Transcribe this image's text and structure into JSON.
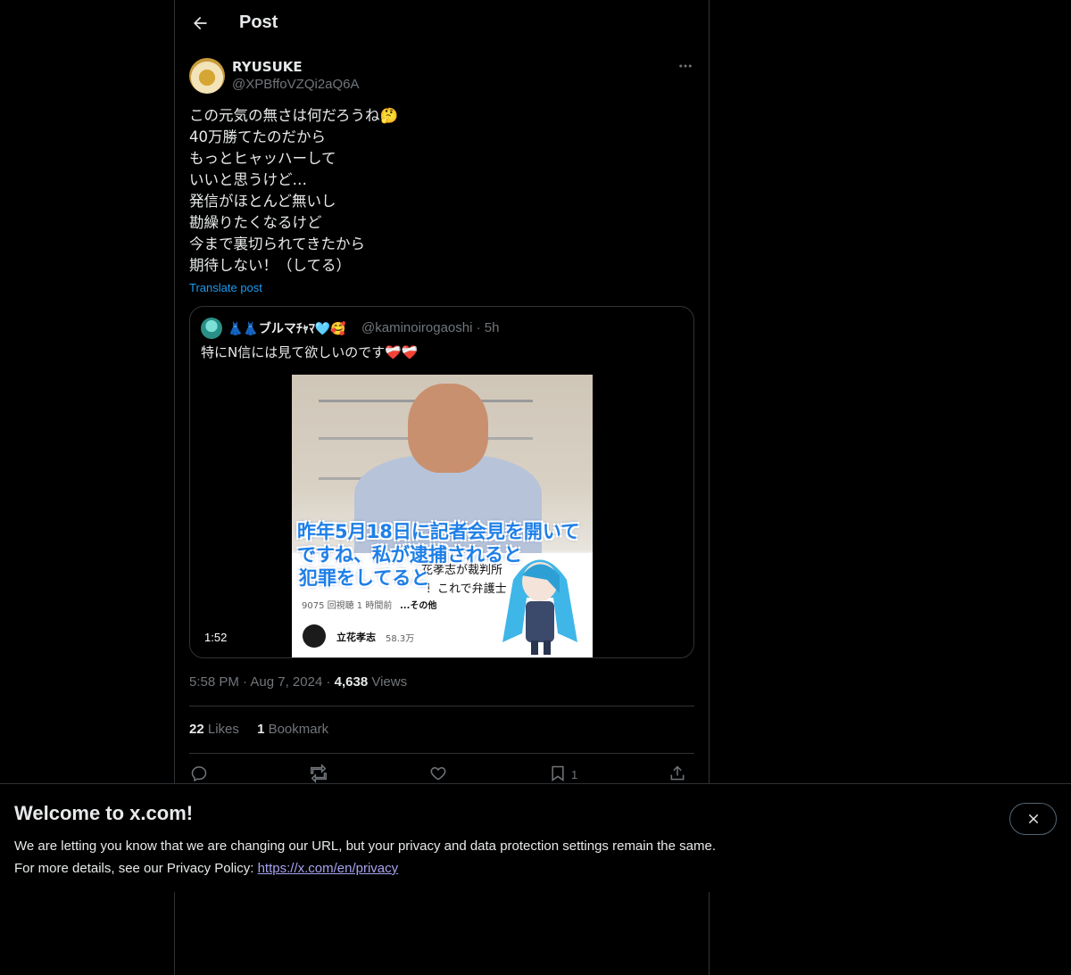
{
  "header": {
    "title": "Post"
  },
  "author": {
    "name": "RYUSUKE",
    "handle": "@XPBffoVZQi2aQ6A"
  },
  "post": {
    "text": "この元気の無さは何だろうね🤔\n40万勝てたのだから\nもっとヒャッハーして\nいいと思うけど…\n発信がほとんど無いし\n勘繰りたくなるけど\n今まで裏切られてきたから\n期待しない！（してる）",
    "translate_label": "Translate post"
  },
  "quote": {
    "name": "👗👗ブルマﾁｬﾏ🩵🥰",
    "handle": "@kaminoirogaoshi · 5h",
    "text": "特にN信には見て欲しいのです❤️‍🩹❤️‍🩹",
    "video": {
      "caption_line1": "昨年5月18日に記者会見を開いて",
      "caption_line2": "ですね、私が逮捕されると",
      "caption_line3": "犯罪をしてると",
      "under_text1": "花孝志が裁判所",
      "under_text2": "！これで弁護士",
      "views_text": "9075 回視聴  1 時間前",
      "more_text": "...その他",
      "channel_name": "立花孝志",
      "channel_subs": "58.3万",
      "duration": "1:52"
    }
  },
  "meta": {
    "time": "5:58 PM",
    "date": "Aug 7, 2024",
    "views_count": "4,638",
    "views_label": "Views"
  },
  "stats": {
    "likes_count": "22",
    "likes_label": "Likes",
    "bookmarks_count": "1",
    "bookmarks_label": "Bookmark"
  },
  "actions": {
    "reply_icon": "reply-icon",
    "repost_icon": "repost-icon",
    "like_icon": "heart-icon",
    "bookmark_icon": "bookmark-icon",
    "bookmark_count": "1",
    "share_icon": "share-icon"
  },
  "banner": {
    "title": "Welcome to x.com!",
    "line1": "We are letting you know that we are changing our URL, but your privacy and data protection settings remain the same.",
    "line2_prefix": "For more details, see our Privacy Policy: ",
    "link_text": "https://x.com/en/privacy"
  },
  "colors": {
    "accent": "#1d9bf0",
    "muted": "#71767b",
    "text": "#e7e9ea",
    "border": "#2f3336"
  }
}
